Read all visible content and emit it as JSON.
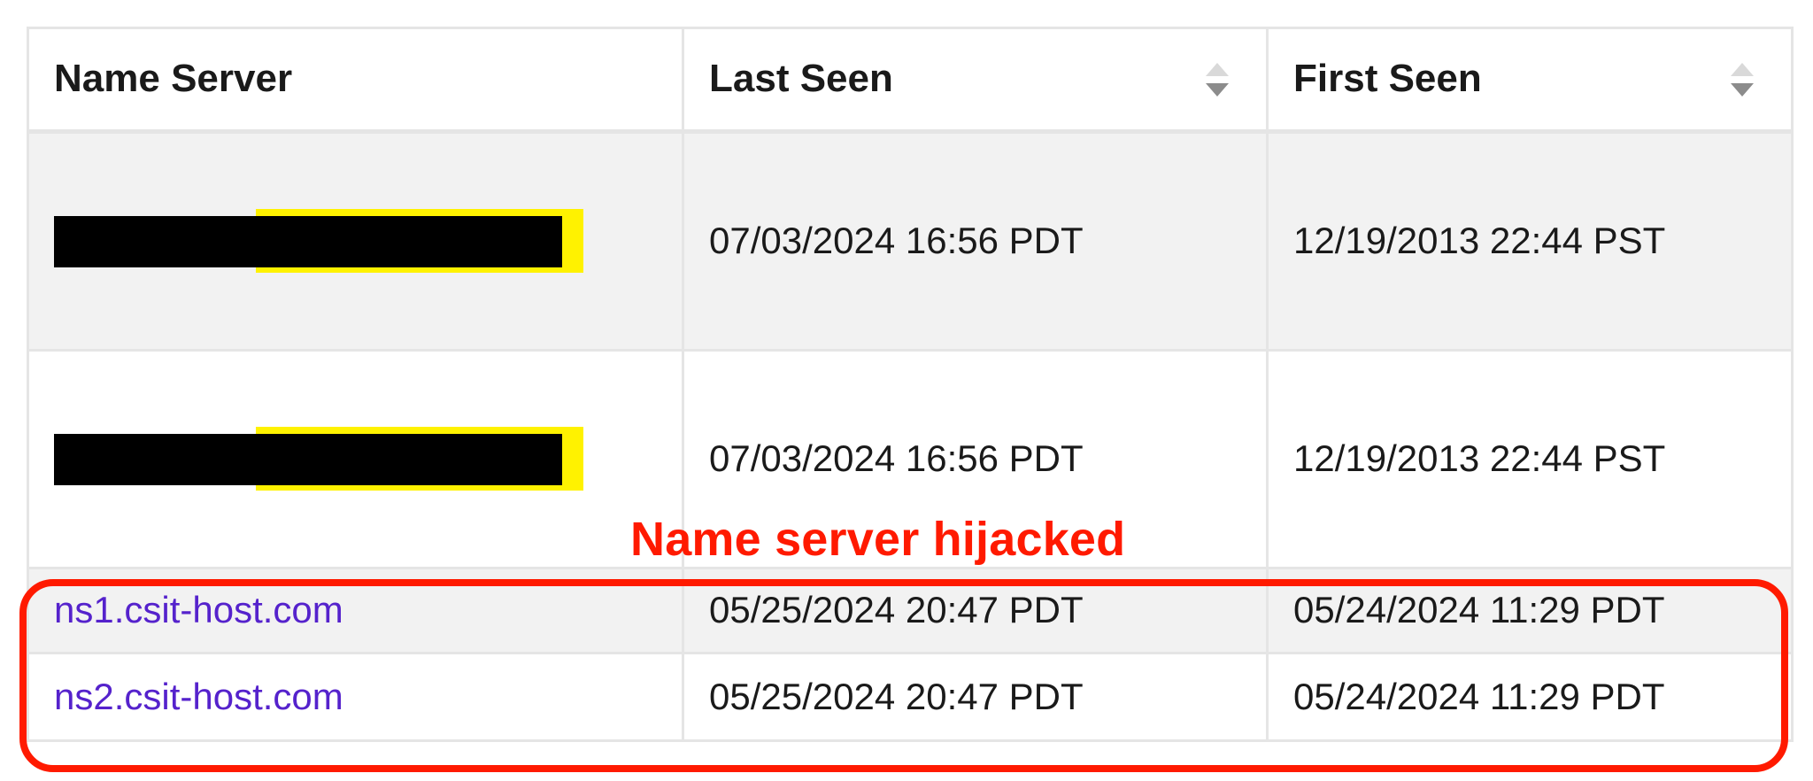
{
  "annotation": {
    "label": "Name server hijacked"
  },
  "table": {
    "headers": {
      "name_server": "Name Server",
      "last_seen": "Last Seen",
      "first_seen": "First Seen"
    },
    "rows": [
      {
        "name_server": "",
        "redacted": true,
        "last_seen": "07/03/2024 16:56 PDT",
        "first_seen": "12/19/2013 22:44 PST"
      },
      {
        "name_server": "",
        "redacted": true,
        "last_seen": "07/03/2024 16:56 PDT",
        "first_seen": "12/19/2013 22:44 PST"
      },
      {
        "name_server": "ns1.csit-host.com",
        "redacted": false,
        "last_seen": "05/25/2024 20:47 PDT",
        "first_seen": "05/24/2024 11:29 PDT"
      },
      {
        "name_server": "ns2.csit-host.com",
        "redacted": false,
        "last_seen": "05/25/2024 20:47 PDT",
        "first_seen": "05/24/2024 11:29 PDT"
      }
    ]
  }
}
